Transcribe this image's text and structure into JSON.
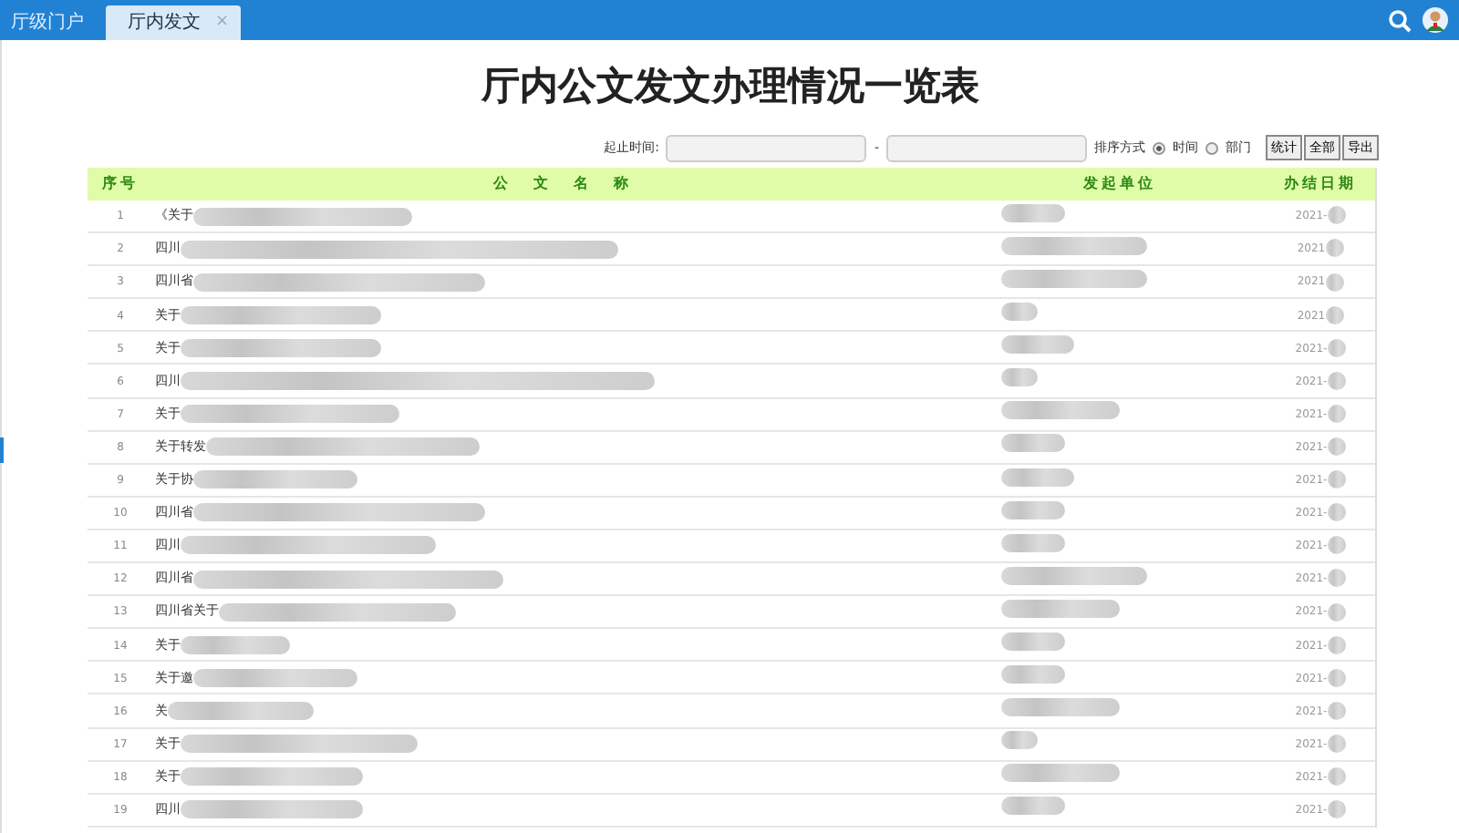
{
  "tabs": [
    {
      "label": "厅级门户",
      "selected": false,
      "closable": false
    },
    {
      "label": "厅内发文",
      "selected": true,
      "closable": true,
      "close": "×"
    }
  ],
  "title": "厅内公文发文办理情况一览表",
  "filter": {
    "range_label": "起止时间:",
    "separator": "-",
    "sort_label": "排序方式",
    "sort_options": [
      {
        "label": "时间",
        "selected": true
      },
      {
        "label": "部门",
        "selected": false
      }
    ],
    "buttons": [
      "统计",
      "全部",
      "导出"
    ]
  },
  "table": {
    "columns": [
      "序号",
      "公文名称",
      "发起单位",
      "办结日期"
    ],
    "rows": [
      {
        "index": "1",
        "title": "《关于",
        "date": "2021-"
      },
      {
        "index": "2",
        "title": "四川",
        "date": "2021"
      },
      {
        "index": "3",
        "title": "四川省",
        "date": "2021"
      },
      {
        "index": "4",
        "title": "关于",
        "date": "2021"
      },
      {
        "index": "5",
        "title": "关于",
        "date": "2021-"
      },
      {
        "index": "6",
        "title": "四川",
        "date": "2021-"
      },
      {
        "index": "7",
        "title": "关于",
        "date": "2021-"
      },
      {
        "index": "8",
        "title": "关于转发",
        "date": "2021-"
      },
      {
        "index": "9",
        "title": "关于协",
        "date": "2021-"
      },
      {
        "index": "10",
        "title": "四川省",
        "date": "2021-"
      },
      {
        "index": "11",
        "title": "四川",
        "date": "2021-"
      },
      {
        "index": "12",
        "title": "四川省",
        "date": "2021-"
      },
      {
        "index": "13",
        "title": "四川省关于",
        "date": "2021-"
      },
      {
        "index": "14",
        "title": "关于",
        "date": "2021-"
      },
      {
        "index": "15",
        "title": "关于邀",
        "date": "2021-"
      },
      {
        "index": "16",
        "title": "关",
        "date": "2021-"
      },
      {
        "index": "17",
        "title": "关于",
        "date": "2021-"
      },
      {
        "index": "18",
        "title": "关于",
        "date": "2021-"
      },
      {
        "index": "19",
        "title": "四川",
        "date": "2021-"
      }
    ]
  }
}
